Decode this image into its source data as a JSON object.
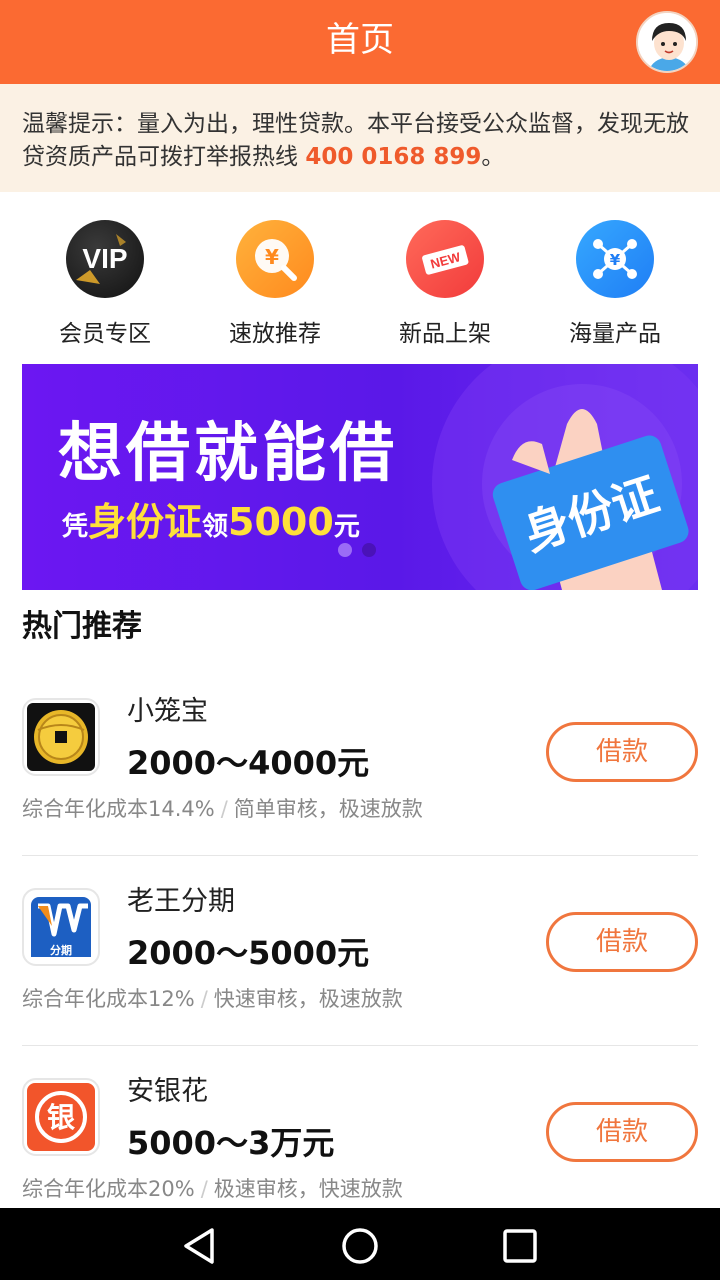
{
  "header": {
    "title": "首页"
  },
  "notice": {
    "text": "温馨提示：量入为出，理性贷款。本平台接受公众监督，发现无放贷资质产品可拨打举报热线 ",
    "hotline": "400 0168 899",
    "end": "。"
  },
  "quick_entries": [
    {
      "label": "会员专区",
      "icon": "vip-icon",
      "badge": "VIP"
    },
    {
      "label": "速放推荐",
      "icon": "fast-loan-icon",
      "badge": "¥"
    },
    {
      "label": "新品上架",
      "icon": "new-icon",
      "badge": "NEW"
    },
    {
      "label": "海量产品",
      "icon": "network-icon",
      "badge": "¥"
    }
  ],
  "banner": {
    "headline": "想借就能借",
    "sub_prefix": "凭",
    "sub_highlight1": "身份证",
    "sub_mid": "领",
    "sub_highlight2": "5000",
    "sub_suffix": "元",
    "card_text": "身份证",
    "active_dot": 0,
    "dot_count": 2
  },
  "section": {
    "title": "热门推荐"
  },
  "products": [
    {
      "name": "小笼宝",
      "amount": "2000～4000元",
      "cost": "综合年化成本14.4%",
      "sep": "/",
      "feature": "简单审核，极速放款",
      "button": "借款",
      "logo": "coin-logo"
    },
    {
      "name": "老王分期",
      "amount": "2000～5000元",
      "cost": "综合年化成本12%",
      "sep": "/",
      "feature": "快速审核，极速放款",
      "button": "借款",
      "logo": "lw-logo",
      "logo_text": "分期"
    },
    {
      "name": "安银花",
      "amount": "5000～3万元",
      "cost": "综合年化成本20%",
      "sep": "/",
      "feature": "极速审核，快速放款",
      "button": "借款",
      "logo": "yin-logo",
      "logo_text": "银"
    }
  ],
  "colors": {
    "primary": "#fb6a32",
    "notice_bg": "#fbf1e4",
    "hotline": "#ef5a2b",
    "button": "#f0763e",
    "banner": "#6c17f2",
    "banner_highlight": "#ffe03a"
  }
}
